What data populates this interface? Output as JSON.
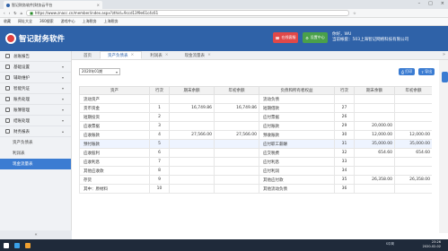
{
  "browser": {
    "tab_title": "智记财务软件|财务云平台",
    "url": "https://www.znacc.cn/member/index.aspx?zthid=9ccd13f9e61c4c61",
    "bookmarks": [
      "收藏",
      "网址大全",
      "360搜索",
      "游戏中心",
      "上海税务",
      "上海税务"
    ]
  },
  "header": {
    "app_name": "智记财务软件",
    "btn_customer_service": "在线客服",
    "btn_settings": "设置中心",
    "user_line": "你好，WU",
    "account_line": "当前帐套：503上海智记网络科技有限公司"
  },
  "sidebar": {
    "items": [
      {
        "label": "总账报告",
        "chev": ""
      },
      {
        "label": "基础设置",
        "chev": "▾"
      },
      {
        "label": "辅助维护",
        "chev": "▾"
      },
      {
        "label": "智能凭证",
        "chev": "▾"
      },
      {
        "label": "账务处理",
        "chev": "▾"
      },
      {
        "label": "账簿管理",
        "chev": "▾"
      },
      {
        "label": "结账处理",
        "chev": "▾"
      },
      {
        "label": "财务报表",
        "chev": "▴"
      }
    ],
    "subitems": [
      "资产负债表",
      "利润表",
      "现金流量表"
    ],
    "active_subitem": 2,
    "collapse_label": "«"
  },
  "tabs": [
    {
      "label": "首页"
    },
    {
      "label": "资产负债表"
    },
    {
      "label": "利润表"
    },
    {
      "label": "现金流量表"
    }
  ],
  "active_tab": 1,
  "toolbar": {
    "period": "2020年01期",
    "print": "打印",
    "export": "导出"
  },
  "table": {
    "headers": [
      "资产",
      "行次",
      "期末余额",
      "年初余额",
      "负债和所有者权益",
      "行次",
      "期末余额",
      "年初余额"
    ],
    "rows": [
      [
        "流动资产",
        "",
        "",
        "",
        "流动负债",
        "",
        "",
        ""
      ],
      [
        "货币资金",
        "1",
        "16,749.86",
        "16,749.86",
        "短期借款",
        "27",
        "",
        ""
      ],
      [
        "短期投资",
        "2",
        "",
        "",
        "应付票据",
        "26",
        "",
        ""
      ],
      [
        "应收票据",
        "3",
        "",
        "",
        "应付账款",
        "29",
        "20,000.00",
        ""
      ],
      [
        "应收账款",
        "4",
        "27,566.00",
        "27,566.00",
        "预收账款",
        "30",
        "12,000.00",
        "12,000.00"
      ],
      [
        "预付账款",
        "5",
        "",
        "",
        "应付职工薪酬",
        "31",
        "35,000.00",
        "35,000.00"
      ],
      [
        "应收股利",
        "6",
        "",
        "",
        "应交税费",
        "32",
        "654.60",
        "654.60"
      ],
      [
        "应收利息",
        "7",
        "",
        "",
        "应付利息",
        "33",
        "",
        ""
      ],
      [
        "其他应收款",
        "8",
        "",
        "",
        "应付利润",
        "34",
        "",
        ""
      ],
      [
        "存货",
        "9",
        "",
        "",
        "其他应付款",
        "35",
        "26,358.00",
        "26,358.00"
      ],
      [
        "其中：原材料",
        "10",
        "",
        "",
        "其他流动负债",
        "36",
        "",
        ""
      ]
    ]
  },
  "taskbar": {
    "ime": "S中简",
    "time": "23:26",
    "date": "2020-02-02"
  }
}
